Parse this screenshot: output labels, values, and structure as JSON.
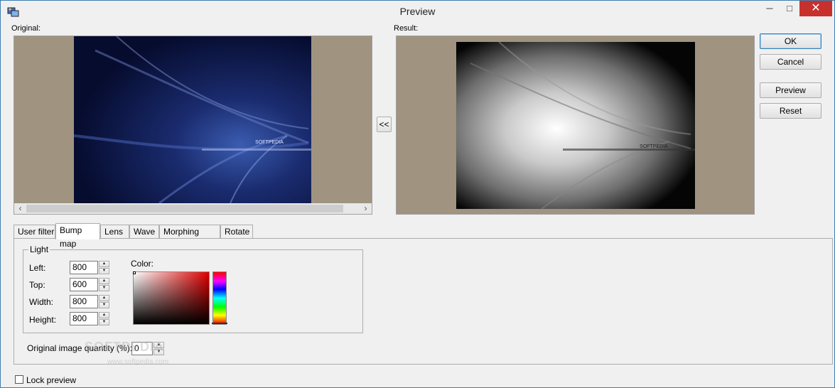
{
  "window": {
    "title": "Preview",
    "controls": {
      "minimize": "─",
      "maximize": "□",
      "close": "✕"
    }
  },
  "original": {
    "label": "Original:"
  },
  "result": {
    "label": "Result:"
  },
  "copy_button": "<<",
  "buttons": {
    "ok": "OK",
    "cancel": "Cancel",
    "preview": "Preview",
    "reset": "Reset"
  },
  "tabs": [
    {
      "label": "User filter",
      "active": false
    },
    {
      "label": "Bump map",
      "active": true
    },
    {
      "label": "Lens",
      "active": false
    },
    {
      "label": "Wave",
      "active": false
    },
    {
      "label": "Morphing filters",
      "active": false
    },
    {
      "label": "Rotate",
      "active": false
    }
  ],
  "light_group": {
    "title": "Light",
    "fields": [
      {
        "label": "Left:",
        "value": "800"
      },
      {
        "label": "Top:",
        "value": "600"
      },
      {
        "label": "Width:",
        "value": "800"
      },
      {
        "label": "Height:",
        "value": "800"
      }
    ],
    "color_label": "Color:"
  },
  "quantity": {
    "label": "Original image quantity (%):",
    "value": "0"
  },
  "lock_preview": {
    "label": "Lock preview",
    "checked": false
  },
  "watermark": {
    "text": "SOFTPEDIA",
    "sub": "www.softpedia.com"
  },
  "image_overlay": {
    "original_text": "SOFTPEDIA",
    "result_text": "SOFTPEDIA"
  },
  "colors": {
    "sand": "#a09380",
    "title_close": "#c7312d",
    "accent": "#3c7fb1"
  }
}
